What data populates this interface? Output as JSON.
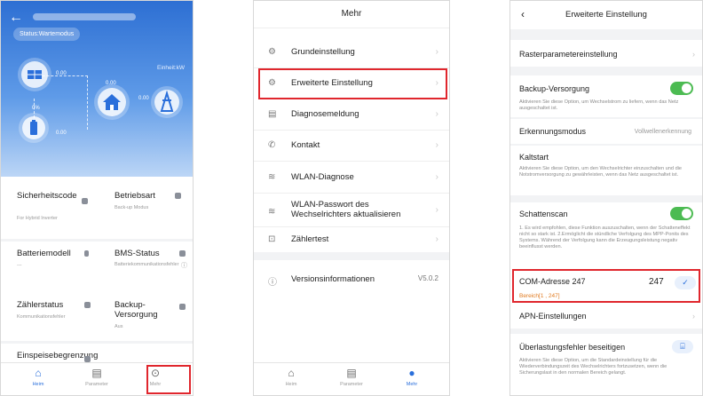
{
  "screen1": {
    "status": "Status:Wartemodus",
    "unit_label": "Einheit:kW",
    "flow_values": {
      "pv": "0.00",
      "grid": "0.00",
      "load": "0.00",
      "battery_soc": "0%",
      "battery": "0.00"
    },
    "cards": [
      {
        "title": "Sicherheitscode",
        "sub": "For Hybrid Inverter"
      },
      {
        "title": "Betriebsart",
        "sub": "Back-up Modus"
      },
      {
        "title": "Batteriemodell",
        "sub": "---"
      },
      {
        "title": "BMS-Status",
        "sub": "Batteriekommunikationsfehler"
      },
      {
        "title": "Zählerstatus",
        "sub": "Kommunikationsfehler"
      },
      {
        "title": "Backup-Versorgung",
        "sub": "Aus"
      },
      {
        "title": "Einspeisebegrenzung",
        "sub": ""
      }
    ],
    "tabs": [
      "Heim",
      "Parameter",
      "Mehr"
    ]
  },
  "screen2": {
    "title": "Mehr",
    "items": [
      "Grundeinstellung",
      "Erweiterte Einstellung",
      "Diagnosemeldung",
      "Kontakt",
      "WLAN-Diagnose",
      "WLAN-Passwort des Wechselrichters aktualisieren",
      "Zählertest",
      "Versionsinformationen"
    ],
    "version": "V5.0.2",
    "tabs": [
      "Heim",
      "Parameter",
      "Mehr"
    ]
  },
  "screen3": {
    "title": "Erweiterte Einstellung",
    "raster": "Rasterparametereinstellung",
    "backup_title": "Backup-Versorgung",
    "backup_desc": "Aktivieren Sie diese Option, um Wechselstrom zu liefern, wenn das Netz ausgeschaltet ist.",
    "erkennung_title": "Erkennungsmodus",
    "erkennung_value": "Vollwellenerkennung",
    "kaltstart_title": "Kaltstart",
    "kaltstart_desc": "Aktivieren Sie diese Option, um den Wechselrichter einzuschalten und die Notstromversorgung zu gewährleisten, wenn das Netz ausgeschaltet ist.",
    "schatten_title": "Schattenscan",
    "schatten_desc": "1. Es wird empfohlen, diese Funktion auszuschalten, wenn der Schatteneffekt nicht so stark ist. 2.Ermöglicht die stündliche Verfolgung des MPP-Ponits des Systems. Während der Verfolgung kann die Erzeugungsleistung negativ beeinflusst werden.",
    "com_title": "COM-Adresse 247",
    "com_value": "247",
    "com_range": "Bereich[1 , 247]",
    "apn": "APN-Einstellungen",
    "overload_title": "Überlastungsfehler beseitigen",
    "overload_desc": "Aktivieren Sie diese Option, um die Standardeinstellung für die Wiederverbindungszeit des Wechselrichters fortzusetzen, wenn die Sicherungslast in den normalen Bereich gelangt."
  },
  "colors": {
    "accent": "#2a6fdb",
    "highlight": "#e0262d",
    "toggle_on": "#4cbb52"
  }
}
